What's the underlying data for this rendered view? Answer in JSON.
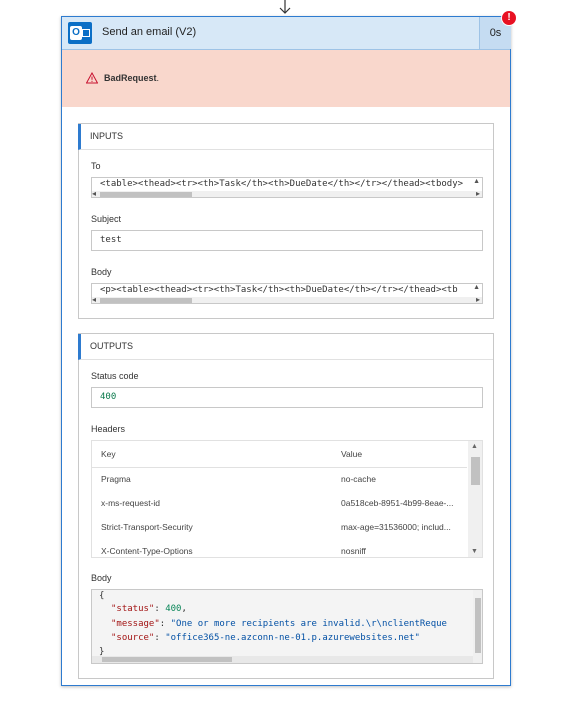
{
  "card": {
    "title": "Send an email (V2)",
    "duration": "0s",
    "error_badge": "!",
    "error_message": "BadRequest",
    "error_period": "."
  },
  "icons": {
    "app": "outlook-icon",
    "warning": "warning-icon",
    "arrow": "arrow-down-icon"
  },
  "inputs": {
    "title": "INPUTS",
    "to_label": "To",
    "to_value": "<table><thead><tr><th>Task</th><th>DueDate</th></tr></thead><tbody>",
    "subject_label": "Subject",
    "subject_value": "test",
    "body_label": "Body",
    "body_value": "<p><table><thead><tr><th>Task</th><th>DueDate</th></tr></thead><tb"
  },
  "outputs": {
    "title": "OUTPUTS",
    "status_label": "Status code",
    "status_value": "400",
    "headers_label": "Headers",
    "headers_columns": [
      "Key",
      "Value"
    ],
    "headers_rows": [
      {
        "key": "Pragma",
        "value": "no-cache"
      },
      {
        "key": "x-ms-request-id",
        "value": "0a518ceb-8951-4b99-8eae-..."
      },
      {
        "key": "Strict-Transport-Security",
        "value": "max-age=31536000; includ..."
      },
      {
        "key": "X-Content-Type-Options",
        "value": "nosniff"
      }
    ],
    "body_label": "Body",
    "body_json": {
      "open": "{",
      "close": "}",
      "status_key": "\"status\"",
      "status_value": "400",
      "message_key": "\"message\"",
      "message_value": "\"One or more recipients are invalid.\\r\\nclientReque",
      "source_key": "\"source\"",
      "source_value": "\"office365-ne.azconn-ne-01.p.azurewebsites.net\""
    }
  },
  "colors": {
    "accent": "#2e7bcf",
    "header_bg": "#d7e8f7",
    "error_bg": "#f9d7cc",
    "error_badge": "#e81123",
    "warning": "#c8102e"
  }
}
